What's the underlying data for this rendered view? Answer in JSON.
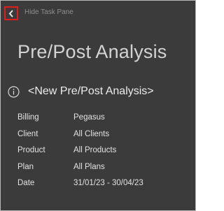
{
  "header": {
    "hide_label": "Hide Task Pane"
  },
  "title": "Pre/Post Analysis",
  "analysis_name": "<New Pre/Post Analysis>",
  "details": [
    {
      "label": "Billing",
      "value": "Pegasus"
    },
    {
      "label": "Client",
      "value": "All Clients"
    },
    {
      "label": "Product",
      "value": "All Products"
    },
    {
      "label": "Plan",
      "value": "All Plans"
    },
    {
      "label": "Date",
      "value": "31/01/23 - 30/04/23"
    }
  ],
  "colors": {
    "background": "#3b3b3b",
    "highlight_border": "#e01c1c",
    "text": "#e6e6e6",
    "muted_text": "#8f8f8f"
  },
  "icons": [
    "chevron-left-icon",
    "info-icon"
  ]
}
